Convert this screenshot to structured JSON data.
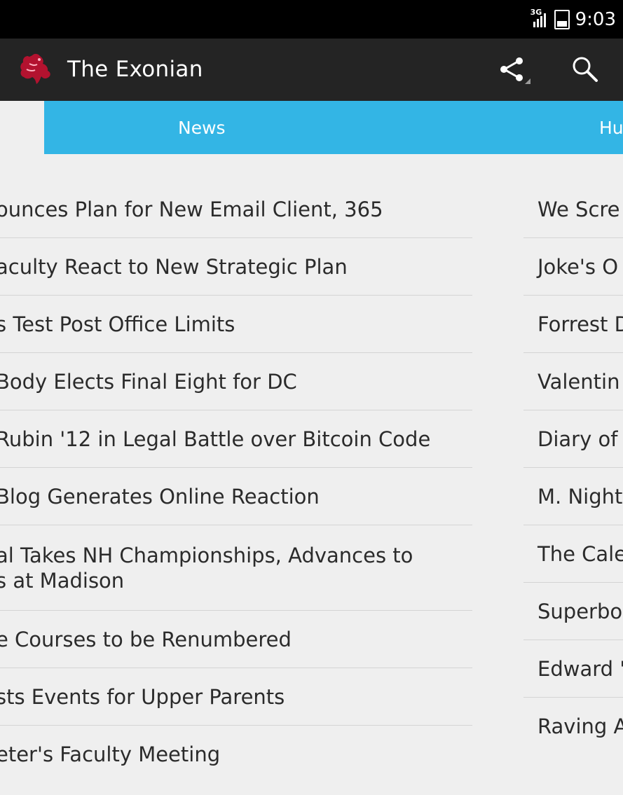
{
  "status_bar": {
    "network": "3G",
    "time": "9:03"
  },
  "header": {
    "title": "The Exonian",
    "actions": [
      "share-icon",
      "search-icon"
    ]
  },
  "tabs": [
    "News",
    "Hu"
  ],
  "news_items": [
    "ounces Plan for New Email Client, 365",
    "aculty React to New Strategic Plan",
    "s Test Post Office Limits",
    "Body Elects Final Eight for DC",
    "Rubin '12 in Legal Battle over Bitcoin Code",
    " Blog Generates Online Reaction",
    "al Takes NH Championships, Advances to\ns at Madison",
    "e Courses to be Renumbered",
    "sts Events for Upper Parents",
    "eter's Faculty Meeting"
  ],
  "humor_items": [
    "We Scre",
    "Joke's O",
    "Forrest D",
    "Valentin",
    "Diary of",
    "M. Night",
    "The Cale",
    "Superbo",
    "Edward '",
    "Raving A"
  ],
  "colors": {
    "status_bar": "#000000",
    "action_bar": "#242424",
    "tab_bar": "#33b5e5",
    "background": "#efefef",
    "logo": "#b3122f"
  }
}
